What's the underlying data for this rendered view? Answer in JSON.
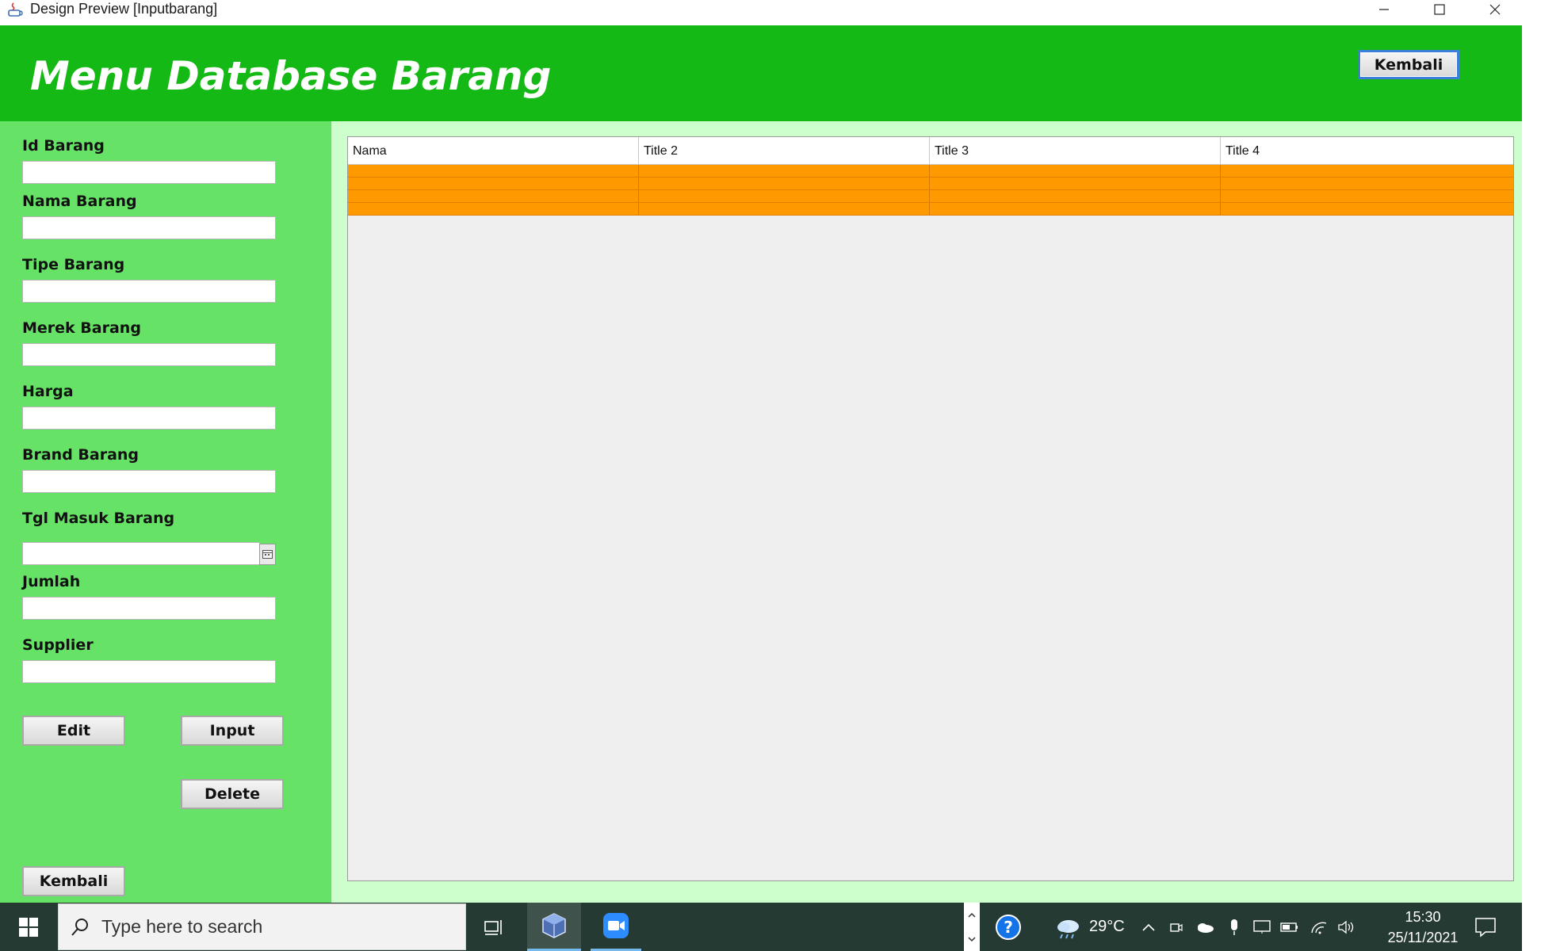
{
  "window": {
    "title": "Design Preview [Inputbarang]"
  },
  "header": {
    "title": "Menu Database Barang",
    "back_label": "Kembali"
  },
  "form": {
    "fields": [
      {
        "label": "Id Barang",
        "value": ""
      },
      {
        "label": "Nama Barang",
        "value": ""
      },
      {
        "label": "Tipe Barang",
        "value": ""
      },
      {
        "label": "Merek Barang",
        "value": ""
      },
      {
        "label": "Harga",
        "value": ""
      },
      {
        "label": "Brand Barang",
        "value": ""
      },
      {
        "label": "Tgl Masuk Barang",
        "value": ""
      },
      {
        "label": "Jumlah",
        "value": ""
      },
      {
        "label": "Supplier",
        "value": ""
      }
    ],
    "edit_label": "Edit",
    "input_label": "Input",
    "delete_label": "Delete",
    "back_label": "Kembali"
  },
  "table": {
    "columns": [
      "Nama",
      "Title 2",
      "Title 3",
      "Title 4"
    ],
    "rows": [
      [
        "",
        "",
        "",
        ""
      ],
      [
        "",
        "",
        "",
        ""
      ],
      [
        "",
        "",
        "",
        ""
      ],
      [
        "",
        "",
        "",
        ""
      ]
    ],
    "row_color": "#ff9900"
  },
  "taskbar": {
    "search_placeholder": "Type here to search",
    "temperature": "29°C",
    "time": "15:30",
    "date": "25/11/2021",
    "icons": [
      "windows-start-icon",
      "search-icon",
      "task-view-icon",
      "virtualbox-icon",
      "zoom-icon",
      "help-icon",
      "weather-icon",
      "chevron-up-icon",
      "meet-now-icon",
      "onedrive-icon",
      "microphone-icon",
      "display-icon",
      "battery-icon",
      "wifi-icon",
      "volume-icon",
      "notification-icon"
    ]
  },
  "colors": {
    "header_green": "#15b915",
    "panel_green": "#66e366",
    "table_panel": "#ccffcc",
    "row_orange": "#ff9900"
  }
}
